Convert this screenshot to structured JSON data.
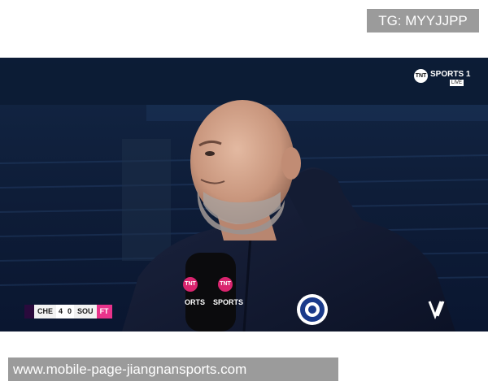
{
  "watermark": {
    "tg_label": "TG: MYYJJPP"
  },
  "broadcast": {
    "channel_logo": "TNT",
    "channel_name": "SPORTS 1",
    "live_badge": "LIVE"
  },
  "scorebug": {
    "home_team": "CHE",
    "home_score": "4",
    "away_score": "0",
    "away_team": "SOU",
    "status": "FT"
  },
  "microphone": {
    "logo_left": "TNT",
    "label_left": "ORTS",
    "logo_right": "TNT",
    "label_right": "SPORTS"
  },
  "footer": {
    "url": "www.mobile-page-jiangnansports.com"
  },
  "colors": {
    "overlay_gray": "#9b9b9b",
    "stadium_blue": "#0d1c35",
    "tnt_pink": "#d9246e",
    "ft_badge": "#e8338b"
  }
}
